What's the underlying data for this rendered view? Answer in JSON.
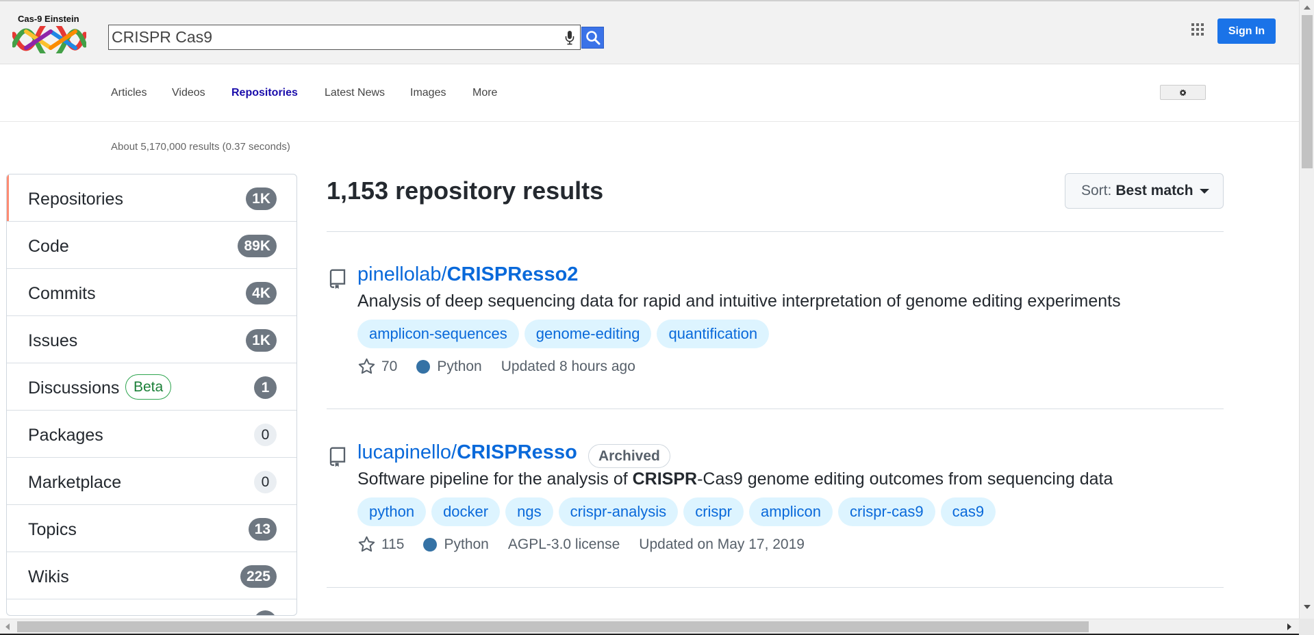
{
  "header": {
    "logo_text": "Cas-9 Einstein",
    "search_value": "CRISPR Cas9",
    "search_icon": "search-icon",
    "mic_icon": "microphone-icon",
    "apps_icon": "apps-grid-icon",
    "signin_label": "Sign In"
  },
  "tabs": {
    "items": [
      {
        "label": "Articles"
      },
      {
        "label": "Videos"
      },
      {
        "label": "Repositories"
      },
      {
        "label": "Latest News"
      },
      {
        "label": "Images"
      },
      {
        "label": "More"
      }
    ],
    "active": "Repositories",
    "tools_icon": "gear-icon"
  },
  "result_stats": "About 5,170,000 results (0.37 seconds)",
  "sidebar": {
    "items": [
      {
        "label": "Repositories",
        "count": "1K"
      },
      {
        "label": "Code",
        "count": "89K"
      },
      {
        "label": "Commits",
        "count": "4K"
      },
      {
        "label": "Issues",
        "count": "1K"
      },
      {
        "label": "Discussions",
        "count": "1",
        "badge": "Beta"
      },
      {
        "label": "Packages",
        "count": "0"
      },
      {
        "label": "Marketplace",
        "count": "0"
      },
      {
        "label": "Topics",
        "count": "13"
      },
      {
        "label": "Wikis",
        "count": "225"
      }
    ]
  },
  "main": {
    "title": "1,153 repository results",
    "sort_prefix": "Sort:",
    "sort_value": "Best match",
    "repos": [
      {
        "owner": "pinellolab",
        "name": "CRISPResso2",
        "description": "Analysis of deep sequencing data for rapid and intuitive interpretation of genome editing experiments",
        "topics": [
          "amplicon-sequences",
          "genome-editing",
          "quantification"
        ],
        "stars": "70",
        "language": "Python",
        "updated": "Updated 8 hours ago"
      },
      {
        "owner": "lucapinello",
        "name": "CRISPResso",
        "archived_label": "Archived",
        "description_pre": "Software pipeline for the analysis of ",
        "description_bold": "CRISPR",
        "description_post": "-Cas9 genome editing outcomes from sequencing data",
        "topics": [
          "python",
          "docker",
          "ngs",
          "crispr-analysis",
          "crispr",
          "amplicon",
          "crispr-cas9",
          "cas9"
        ],
        "stars": "115",
        "language": "Python",
        "license": "AGPL-3.0 license",
        "updated": "Updated on May 17, 2019"
      }
    ]
  },
  "colors": {
    "link": "#0969da",
    "active_tab": "#1a0dab",
    "signin": "#1a73e8",
    "python": "#3572a5",
    "topic_bg": "#ddf4ff",
    "active_marker": "#fd8c73"
  }
}
